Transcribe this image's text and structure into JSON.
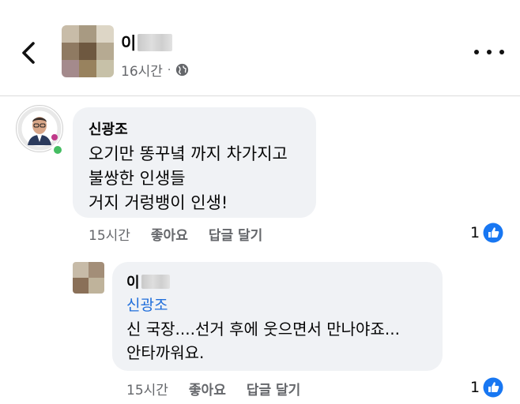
{
  "header": {
    "back_icon": "chevron-left-icon",
    "author_name": "이",
    "timestamp": "16시간",
    "separator": "·",
    "privacy_icon": "globe-icon",
    "more_icon": "more-horizontal-icon"
  },
  "comments": [
    {
      "author": "신광조",
      "text": "오기만 똥꾸녘 까지 차가지고\n불쌍한 인생들\n거지 거렁뱅이 인생!",
      "time": "15시간",
      "like_label": "좋아요",
      "reply_label": "답글 달기",
      "reaction_count": "1",
      "reaction_icon": "like-thumb-icon",
      "online": true
    },
    {
      "author": "이",
      "mention": "신광조",
      "text": "신 국장....선거 후에 웃으면서 만나야죠...\n안타까워요.",
      "time": "15시간",
      "like_label": "좋아요",
      "reply_label": "답글 달기",
      "reaction_count": "1",
      "reaction_icon": "like-thumb-icon"
    }
  ],
  "colors": {
    "bubble": "#f0f2f5",
    "meta_text": "#65676b",
    "mention": "#216fdb",
    "like_blue": "#1877f2",
    "online": "#45bd62"
  }
}
